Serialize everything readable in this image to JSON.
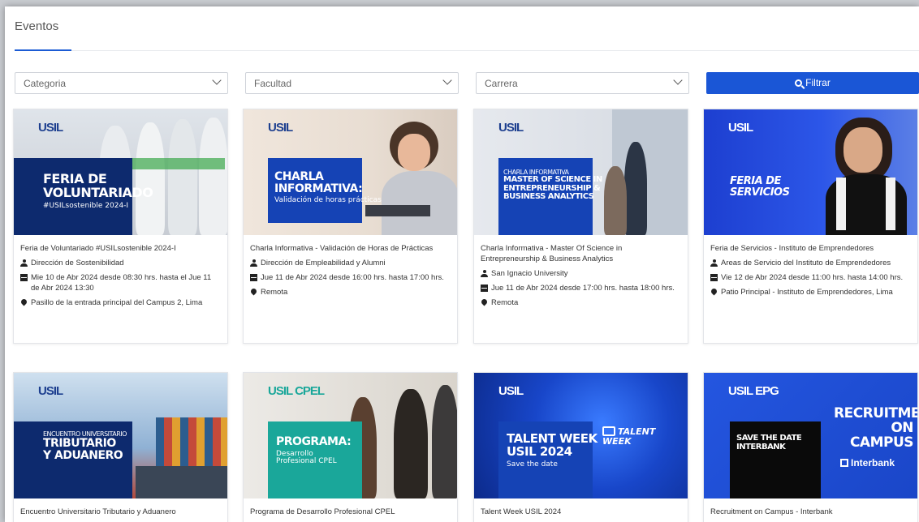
{
  "page": {
    "title": "Eventos"
  },
  "filters": {
    "categoria": "Categoria",
    "facultad": "Facultad",
    "carrera": "Carrera",
    "button": "Filtrar"
  },
  "colors": {
    "accent": "#1a56d6",
    "navy": "#0d2a6e",
    "teal": "#1aa79a"
  },
  "cards": [
    {
      "image": {
        "logo": "USIL",
        "headline": [
          "FERIA DE",
          "VOLUNTARIADO"
        ],
        "sub": "#USILsostenible 2024-I"
      },
      "name": "Feria de Voluntariado #USILsostenible 2024-I",
      "organizer": "Dirección de Sostenibilidad",
      "date": "Mie 10 de Abr 2024 desde 08:30 hrs. hasta el Jue 11 de Abr 2024 13:30",
      "location": "Pasillo de la entrada principal del Campus 2, Lima"
    },
    {
      "image": {
        "logo": "USIL",
        "headline": [
          "CHARLA",
          "INFORMATIVA:"
        ],
        "sub": "Validación de horas prácticas"
      },
      "name": "Charla Informativa - Validación de Horas de Prácticas",
      "organizer": "Dirección de Empleabilidad y Alumni",
      "date": "Jue 11 de Abr 2024 desde 16:00 hrs. hasta 17:00 hrs.",
      "location": "Remota"
    },
    {
      "image": {
        "logo": "USIL",
        "headline": [
          "CHARLA INFORMATIVA",
          "MASTER OF SCIENCE IN",
          "ENTREPRENEURSHIP &",
          "BUSINESS ANALYTICS"
        ],
        "sub": ""
      },
      "name": "Charla Informativa - Master Of Science in Entrepreneurship & Business Analytics",
      "organizer": "San Ignacio University",
      "date": "Jue 11 de Abr 2024 desde 17:00 hrs. hasta 18:00 hrs.",
      "location": "Remota"
    },
    {
      "image": {
        "logo": "USIL",
        "headline": [
          "FERIA DE",
          "SERVICIOS"
        ],
        "sub": ""
      },
      "name": "Feria de Servicios - Instituto de Emprendedores",
      "organizer": "Areas de Servicio del Instituto de Emprendedores",
      "date": "Vie 12 de Abr 2024 desde 11:00 hrs. hasta 14:00 hrs.",
      "location": "Patio Principal - Instituto de Emprendedores, Lima"
    },
    {
      "image": {
        "logo": "USIL",
        "headline": [
          "ENCUENTRO UNIVERSITARIO",
          "TRIBUTARIO",
          "Y ADUANERO"
        ],
        "sub": ""
      },
      "name": "Encuentro Universitario Tributario y Aduanero"
    },
    {
      "image": {
        "logo": "USIL CPEL",
        "headline": [
          "PROGRAMA:"
        ],
        "sub": "Desarrollo Profesional CPEL"
      },
      "name": "Programa de Desarrollo Profesional CPEL"
    },
    {
      "image": {
        "logo": "USIL",
        "headline": [
          "TALENT WEEK",
          "USIL 2024"
        ],
        "sub": "Save the date",
        "badge": "TALENT WEEK"
      },
      "name": "Talent Week USIL 2024"
    },
    {
      "image": {
        "logo": "USIL EPG",
        "headline": [
          "SAVE THE DATE",
          "INTERBANK"
        ],
        "sub": "",
        "right": [
          "RECRUITMENT",
          "ON CAMPUS"
        ],
        "brand": "Interbank"
      },
      "name": "Recruitment on Campus - Interbank"
    }
  ]
}
